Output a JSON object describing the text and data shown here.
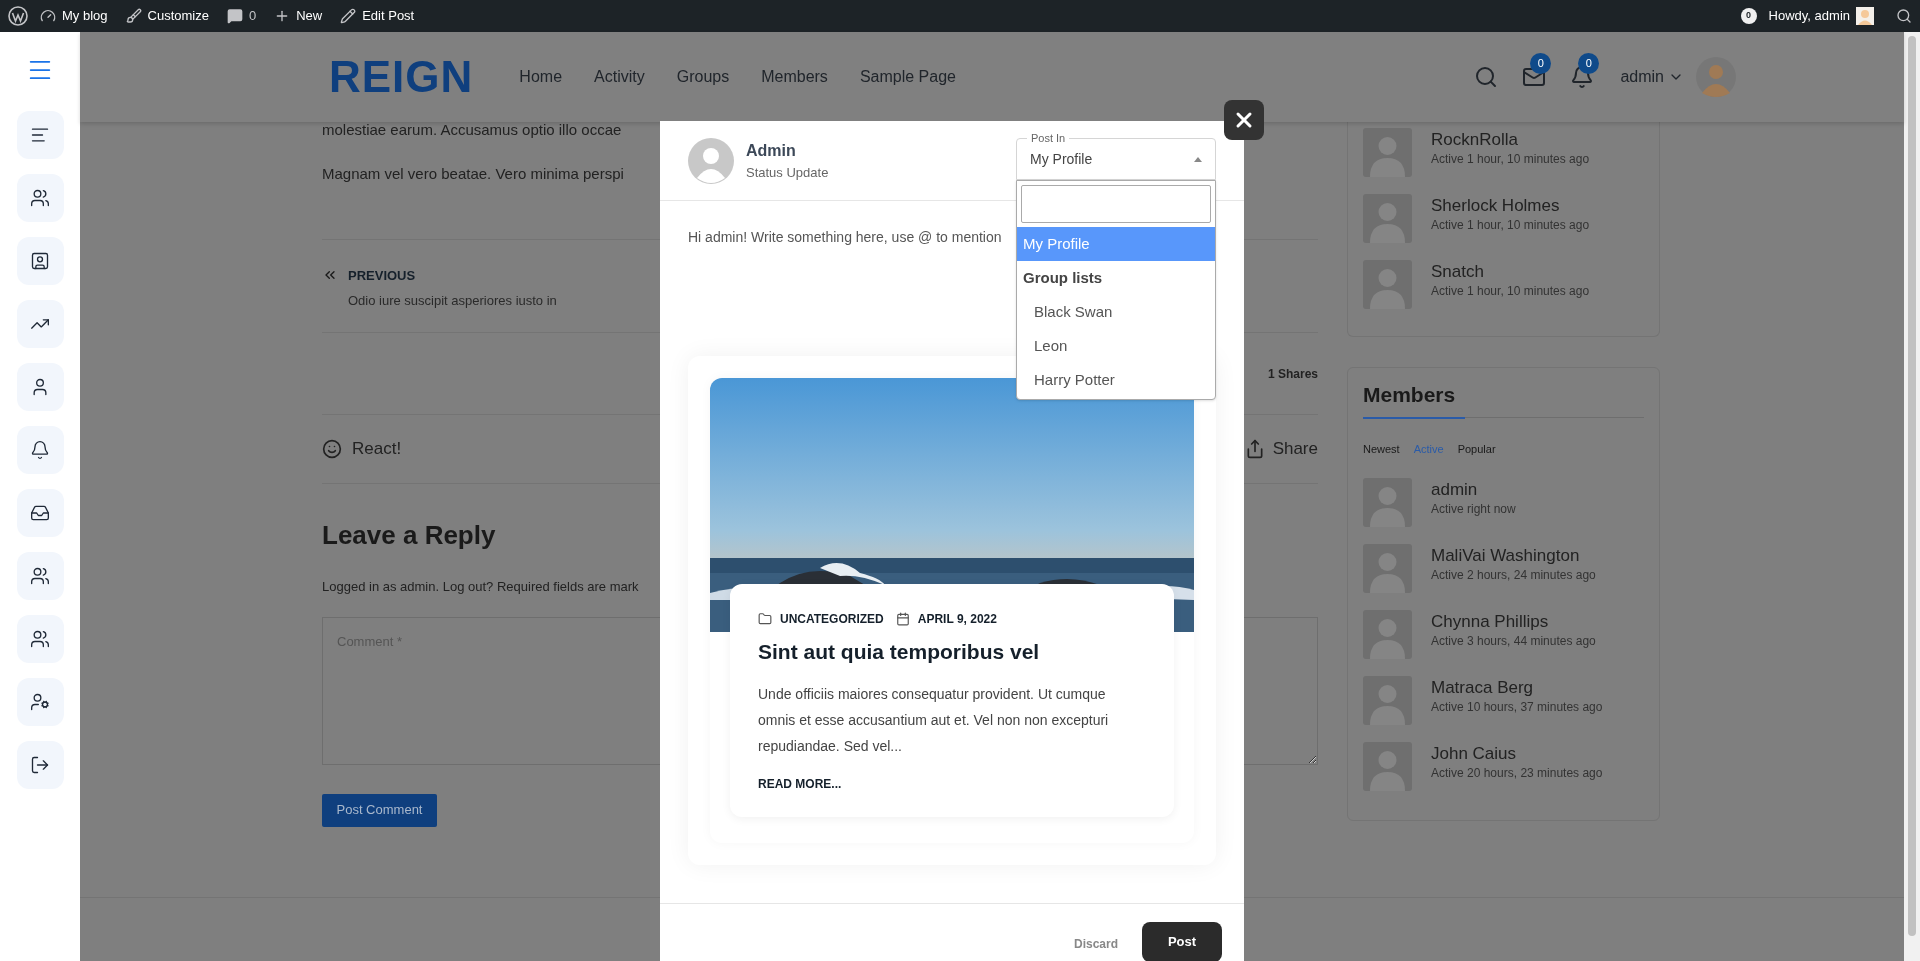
{
  "admin_bar": {
    "items": [
      {
        "kind": "site",
        "label": "My blog"
      },
      {
        "kind": "customize",
        "label": "Customize"
      },
      {
        "kind": "comments",
        "label": "0"
      },
      {
        "kind": "new",
        "label": "New"
      },
      {
        "kind": "edit",
        "label": "Edit Post"
      }
    ],
    "count": "0",
    "greeting": "Howdy, admin"
  },
  "header": {
    "logo": "REIGN",
    "nav": [
      "Home",
      "Activity",
      "Groups",
      "Members",
      "Sample Page"
    ],
    "messages_badge": "0",
    "notifications_badge": "0",
    "user": "admin"
  },
  "content": {
    "paragraphs": [
      "molestiae earum. Accusamus optio illo occae",
      "Magnam vel vero beatae. Vero minima perspi"
    ],
    "previous": {
      "label": "PREVIOUS",
      "title": "Odio iure suscipit asperiores iusto in"
    },
    "shares": "1 Shares",
    "react": "React!",
    "share": "Share",
    "reply": {
      "title": "Leave a Reply",
      "note": "Logged in as admin. Log out? Required fields are mark",
      "comment_placeholder": "Comment *",
      "submit": "Post Comment"
    }
  },
  "recent_members": [
    {
      "name": "RocknRolla",
      "activity": "Active 1 hour, 10 minutes ago"
    },
    {
      "name": "Sherlock Holmes",
      "activity": "Active 1 hour, 10 minutes ago"
    },
    {
      "name": "Snatch",
      "activity": "Active 1 hour, 10 minutes ago"
    }
  ],
  "members_widget": {
    "title": "Members",
    "tabs": [
      {
        "label": "Newest",
        "selected": false
      },
      {
        "label": "Active",
        "selected": true
      },
      {
        "label": "Popular",
        "selected": false
      }
    ],
    "items": [
      {
        "name": "admin",
        "activity": "Active right now"
      },
      {
        "name": "MaliVai Washington",
        "activity": "Active 2 hours, 24 minutes ago"
      },
      {
        "name": "Chynna Phillips",
        "activity": "Active 3 hours, 44 minutes ago"
      },
      {
        "name": "Matraca Berg",
        "activity": "Active 10 hours, 37 minutes ago"
      },
      {
        "name": "John Caius",
        "activity": "Active 20 hours, 23 minutes ago"
      }
    ]
  },
  "modal": {
    "author": "Admin",
    "subtitle": "Status Update",
    "post_in": {
      "label": "Post In",
      "value": "My Profile",
      "expanded": true,
      "options": [
        {
          "label": "My Profile",
          "selected": true
        }
      ],
      "groups": [
        {
          "label": "Group lists",
          "options": [
            {
              "label": "Black Swan",
              "selected": false
            },
            {
              "label": "Leon",
              "selected": false
            },
            {
              "label": "Harry Potter",
              "selected": false
            }
          ]
        }
      ]
    },
    "placeholder": "Hi admin! Write something here, use @ to mention",
    "preview": {
      "kind": "picture",
      "category": "UNCATEGORIZED",
      "date": "APRIL 9, 2022",
      "title": "Sint aut quia temporibus vel",
      "excerpt": "Unde officiis maiores consequatur provident. Ut cumque omnis et esse accusantium aut et. Vel non non excepturi repudiandae. Sed vel...",
      "read_more": "READ MORE..."
    },
    "discard": "Discard",
    "post": "Post"
  }
}
